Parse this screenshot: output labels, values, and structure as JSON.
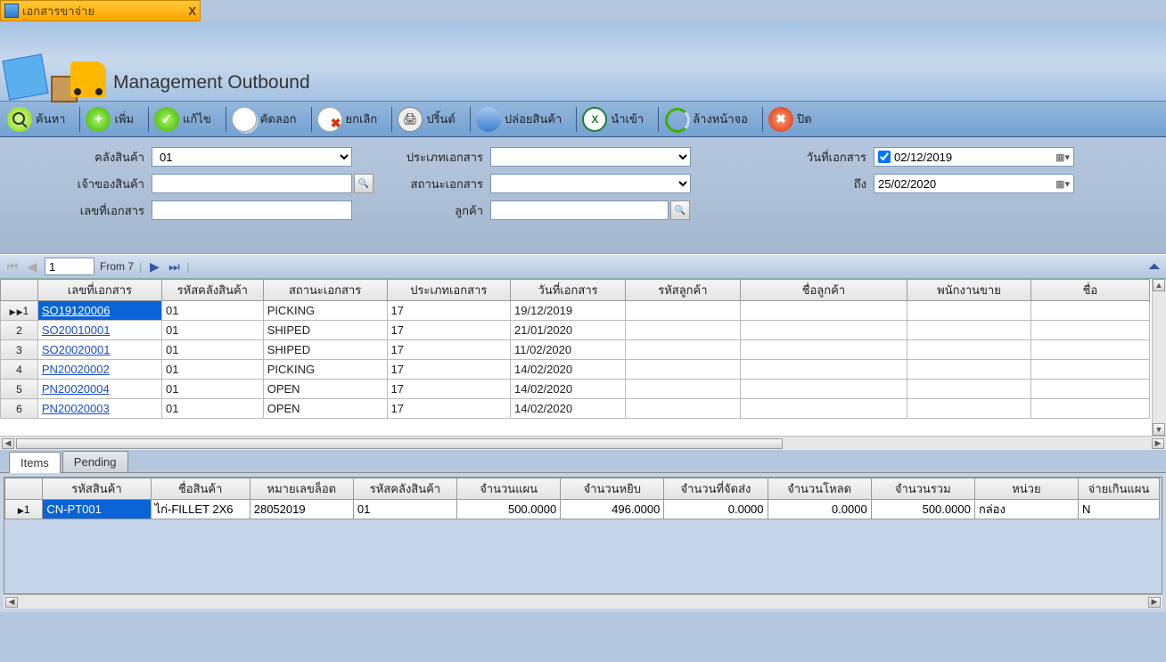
{
  "window": {
    "title": "เอกสารขาจ่าย"
  },
  "header": {
    "title": "Management Outbound"
  },
  "toolbar": {
    "search": "ค้นหา",
    "add": "เพิ่ม",
    "edit": "แก้ไข",
    "copy": "คัดลอก",
    "cancel": "ยกเลิก",
    "print": "ปริ้นต์",
    "release": "ปล่อยสินค้า",
    "import": "นำเข้า",
    "clear": "ล้างหน้าจอ",
    "close": "ปิด"
  },
  "filters": {
    "warehouse_label": "คลังสินค้า",
    "warehouse_value": "01",
    "owner_label": "เจ้าของสินค้า",
    "owner_value": "",
    "docno_label": "เลขที่เอกสาร",
    "docno_value": "",
    "doctype_label": "ประเภทเอกสาร",
    "doctype_value": "",
    "docstatus_label": "สถานะเอกสาร",
    "docstatus_value": "",
    "customer_label": "ลูกค้า",
    "customer_value": "",
    "docdate_label": "วันที่เอกสาร",
    "date_from": "02/12/2019",
    "to_label": "ถึง",
    "date_to": "25/02/2020"
  },
  "pager": {
    "page": "1",
    "from_text": "From 7"
  },
  "grid": {
    "headers": [
      "เลขที่เอกสาร",
      "รหัสคลังสินค้า",
      "สถานะเอกสาร",
      "ประเภทเอกสาร",
      "วันที่เอกสาร",
      "รหัสลูกค้า",
      "ชื่อลูกค้า",
      "พนักงานขาย",
      "ชื่อ"
    ],
    "rows": [
      {
        "n": "1",
        "doc": "SO19120006",
        "wh": "01",
        "status": "PICKING",
        "type": "17",
        "date": "19/12/2019",
        "cust": "",
        "custname": "",
        "sales": "",
        "name": ""
      },
      {
        "n": "2",
        "doc": "SO20010001",
        "wh": "01",
        "status": "SHIPED",
        "type": "17",
        "date": "21/01/2020",
        "cust": "",
        "custname": "",
        "sales": "",
        "name": ""
      },
      {
        "n": "3",
        "doc": "SO20020001",
        "wh": "01",
        "status": "SHIPED",
        "type": "17",
        "date": "11/02/2020",
        "cust": "",
        "custname": "",
        "sales": "",
        "name": ""
      },
      {
        "n": "4",
        "doc": "PN20020002",
        "wh": "01",
        "status": "PICKING",
        "type": "17",
        "date": "14/02/2020",
        "cust": "",
        "custname": "",
        "sales": "",
        "name": ""
      },
      {
        "n": "5",
        "doc": "PN20020004",
        "wh": "01",
        "status": "OPEN",
        "type": "17",
        "date": "14/02/2020",
        "cust": "",
        "custname": "",
        "sales": "",
        "name": ""
      },
      {
        "n": "6",
        "doc": "PN20020003",
        "wh": "01",
        "status": "OPEN",
        "type": "17",
        "date": "14/02/2020",
        "cust": "",
        "custname": "",
        "sales": "",
        "name": ""
      }
    ]
  },
  "tabs": {
    "items": "Items",
    "pending": "Pending"
  },
  "detail": {
    "headers": [
      "รหัสสินค้า",
      "ชื่อสินค้า",
      "หมายเลขล็อต",
      "รหัสคลังสินค้า",
      "จำนวนแผน",
      "จำนวนหยิบ",
      "จำนวนที่จัดส่ง",
      "จำนวนโหลด",
      "จำนวนรวม",
      "หน่วย",
      "จ่ายเกินแผน"
    ],
    "rows": [
      {
        "n": "1",
        "code": "CN-PT001",
        "name": "ไก่-FILLET 2X6",
        "lot": "28052019",
        "wh": "01",
        "plan": "500.0000",
        "pick": "496.0000",
        "ship": "0.0000",
        "load": "0.0000",
        "total": "500.0000",
        "unit": "กล่อง",
        "over": "N"
      }
    ]
  }
}
